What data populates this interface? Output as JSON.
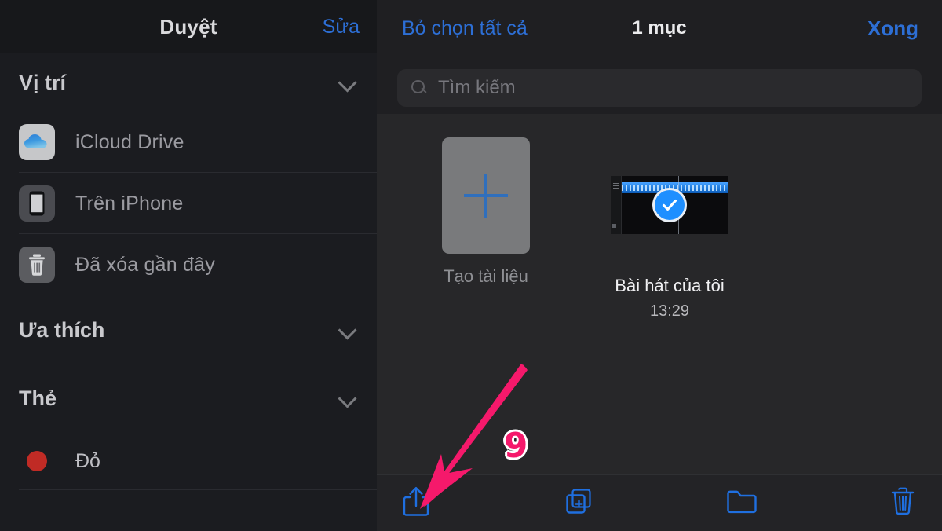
{
  "sidebar": {
    "title": "Duyệt",
    "edit_label": "Sửa",
    "sections": [
      {
        "label": "Vị trí",
        "chevron": "chevron-down-icon"
      },
      {
        "label": "Ưa thích",
        "chevron": "chevron-down-icon"
      },
      {
        "label": "Thẻ",
        "chevron": "chevron-down-icon"
      }
    ],
    "locations": [
      {
        "label": "iCloud Drive",
        "icon": "icloud-drive-icon"
      },
      {
        "label": "Trên iPhone",
        "icon": "iphone-icon"
      },
      {
        "label": "Đã xóa gần đây",
        "icon": "trash-icon"
      }
    ],
    "tags": [
      {
        "label": "Đỏ",
        "color": "#c02b25",
        "icon": "tag-dot-icon"
      }
    ]
  },
  "main": {
    "deselect_all_label": "Bỏ chọn tất cả",
    "item_count_label": "1 mục",
    "done_label": "Xong",
    "search": {
      "placeholder": "Tìm kiếm",
      "value": "",
      "icon": "search-icon"
    },
    "items": [
      {
        "type": "new-document",
        "label": "Tạo tài liệu",
        "icon": "plus-icon",
        "time": "",
        "selected": false
      },
      {
        "type": "file",
        "label": "Bài hát của tôi",
        "icon": "audio-waveform-thumbnail",
        "time": "13:29",
        "selected": true,
        "selected_icon": "check-circle-icon"
      }
    ],
    "toolbar": [
      {
        "name": "share-icon",
        "label": "Chia sẻ"
      },
      {
        "name": "duplicate-icon",
        "label": "Nhân bản"
      },
      {
        "name": "folder-icon",
        "label": "Di chuyển"
      },
      {
        "name": "trash-icon",
        "label": "Xóa"
      }
    ]
  },
  "annotation": {
    "step_number": "9",
    "arrow_color": "#f5196b",
    "badge_text_color": "#f5196b"
  },
  "colors": {
    "accent_blue": "#2d6fd6",
    "toolbar_blue": "#1f6fe0",
    "selection_blue": "#1e8fff",
    "tag_red": "#c02b25",
    "annotation_pink": "#f5196b"
  }
}
